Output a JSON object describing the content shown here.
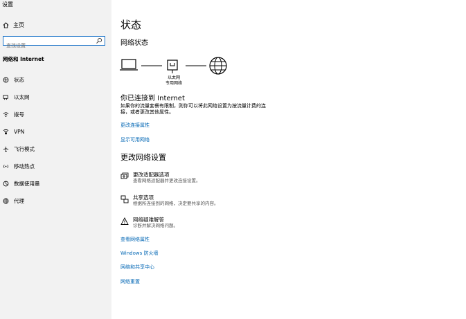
{
  "window": {
    "title": "设置"
  },
  "sidebar": {
    "home_label": "主页",
    "search_placeholder": "查找设置",
    "section_title": "网络和 Internet",
    "items": [
      {
        "label": "状态",
        "icon": "status-icon"
      },
      {
        "label": "以太网",
        "icon": "ethernet-icon"
      },
      {
        "label": "拨号",
        "icon": "dialup-icon"
      },
      {
        "label": "VPN",
        "icon": "vpn-icon"
      },
      {
        "label": "飞行模式",
        "icon": "airplane-icon"
      },
      {
        "label": "移动热点",
        "icon": "hotspot-icon"
      },
      {
        "label": "数据使用量",
        "icon": "data-usage-icon"
      },
      {
        "label": "代理",
        "icon": "proxy-icon"
      }
    ]
  },
  "main": {
    "title": "状态",
    "network_status_heading": "网络状态",
    "diagram": {
      "adapter_label": "以太网",
      "network_label": "专用网络"
    },
    "connected_title": "你已连接到 Internet",
    "connected_desc": "如果你的流量套餐有限制，则你可以将此网络设置为按流量计费的连接，或者更改其他属性。",
    "links_top": [
      "更改连接属性",
      "显示可用网络"
    ],
    "change_heading": "更改网络设置",
    "options": [
      {
        "title": "更改适配器选项",
        "desc": "查看网络适配器并更改连接设置。",
        "icon": "adapter-icon"
      },
      {
        "title": "共享选项",
        "desc": "根据所连接到的网络，决定要共享的内容。",
        "icon": "sharing-icon"
      },
      {
        "title": "网络疑难解答",
        "desc": "诊断并解决网络问题。",
        "icon": "warning-icon"
      }
    ],
    "links_bottom": [
      "查看网络属性",
      "Windows 防火墙",
      "网络和共享中心",
      "网络重置"
    ]
  },
  "colors": {
    "link": "#0066b4",
    "focus": "#1a73c9",
    "sidebar_bg": "#f2f2f2"
  }
}
